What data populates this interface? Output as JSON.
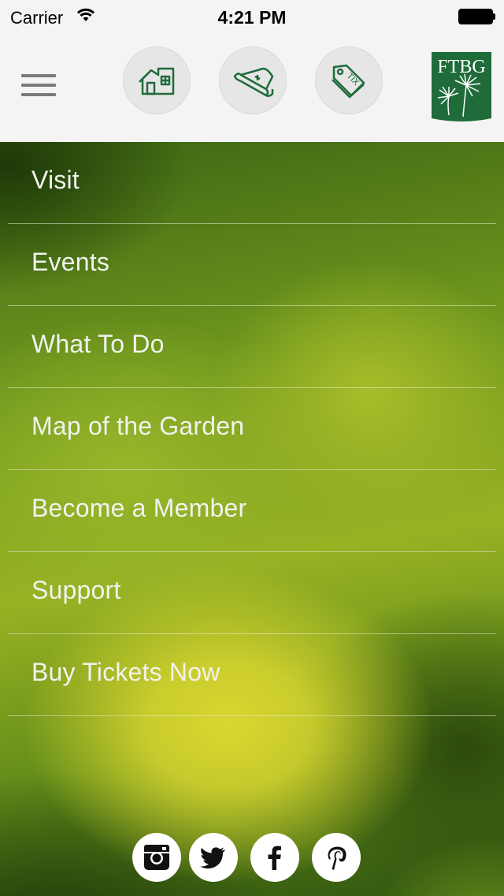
{
  "status_bar": {
    "carrier": "Carrier",
    "time": "4:21 PM"
  },
  "toolbar": {
    "menu_icon": "hamburger-menu-icon",
    "buttons": [
      {
        "icon": "home-icon"
      },
      {
        "icon": "map-icon"
      },
      {
        "icon": "ticket-icon"
      }
    ],
    "logo": {
      "text": "FTBG",
      "icon": "palm-leaf-logo"
    }
  },
  "colors": {
    "brand_green": "#1f6b3a",
    "menu_text": "#f2f2ee",
    "toolbar_bg": "#f4f4f4"
  },
  "menu": {
    "items": [
      {
        "label": "Visit"
      },
      {
        "label": "Events"
      },
      {
        "label": "What To Do"
      },
      {
        "label": "Map of the Garden"
      },
      {
        "label": "Become a Member"
      },
      {
        "label": "Support"
      },
      {
        "label": "Buy Tickets Now"
      }
    ]
  },
  "social": [
    {
      "icon": "instagram-icon"
    },
    {
      "icon": "twitter-icon"
    },
    {
      "icon": "facebook-icon"
    },
    {
      "icon": "pinterest-icon"
    }
  ]
}
